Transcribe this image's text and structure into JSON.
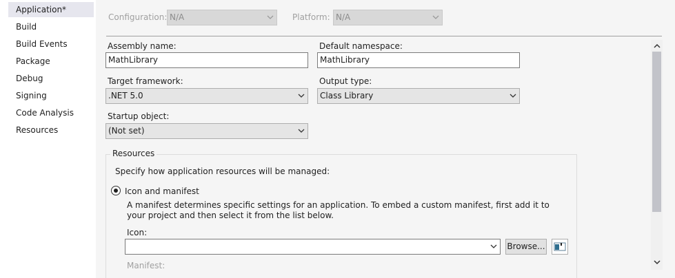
{
  "sidebar": {
    "items": [
      {
        "label": "Application*"
      },
      {
        "label": "Build"
      },
      {
        "label": "Build Events"
      },
      {
        "label": "Package"
      },
      {
        "label": "Debug"
      },
      {
        "label": "Signing"
      },
      {
        "label": "Code Analysis"
      },
      {
        "label": "Resources"
      }
    ]
  },
  "config_row": {
    "configuration_label": "Configuration:",
    "configuration_value": "N/A",
    "platform_label": "Platform:",
    "platform_value": "N/A"
  },
  "general": {
    "assembly_name_label": "Assembly name:",
    "assembly_name_value": "MathLibrary",
    "default_namespace_label": "Default namespace:",
    "default_namespace_value": "MathLibrary",
    "target_framework_label": "Target framework:",
    "target_framework_value": ".NET 5.0",
    "output_type_label": "Output type:",
    "output_type_value": "Class Library",
    "startup_object_label": "Startup object:",
    "startup_object_value": "(Not set)"
  },
  "resources": {
    "group_title": "Resources",
    "description": "Specify how application resources will be managed:",
    "icon_manifest_label": "Icon and manifest",
    "manifest_help_line1": "A manifest determines specific settings for an application. To embed a custom manifest, first add it to",
    "manifest_help_line2": "your project and then select it from the list below.",
    "icon_label": "Icon:",
    "icon_value": "",
    "browse_label": "Browse...",
    "manifest_label": "Manifest:"
  }
}
